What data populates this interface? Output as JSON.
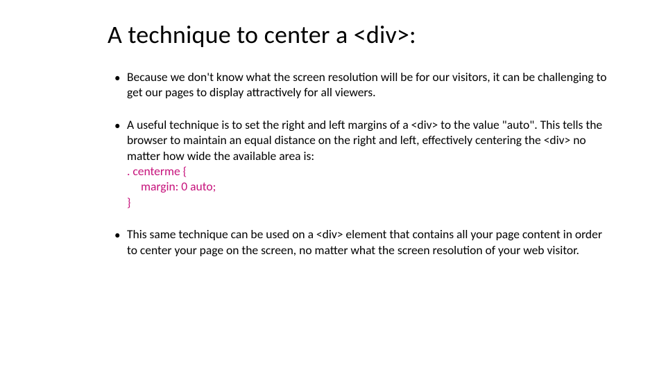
{
  "title": "A technique to center a <div>:",
  "bullets": {
    "b1": "Because we don't know what the screen resolution will be for our visitors, it can be challenging to get our pages to display attractively for all viewers.",
    "b2_intro": "A useful technique is to set the right and left margins of a <div> to the value \"auto\".  This tells the browser to maintain an equal distance on the right and left, effectively centering the <div> no matter how wide the available area is:",
    "b2_code_line1": ". centerme {",
    "b2_code_line2": "margin: 0 auto;",
    "b2_code_line3": "}",
    "b3": "This same technique can be used on a <div> element that contains all your page content in order to center your page on the screen, no matter what the screen resolution of your web visitor."
  }
}
